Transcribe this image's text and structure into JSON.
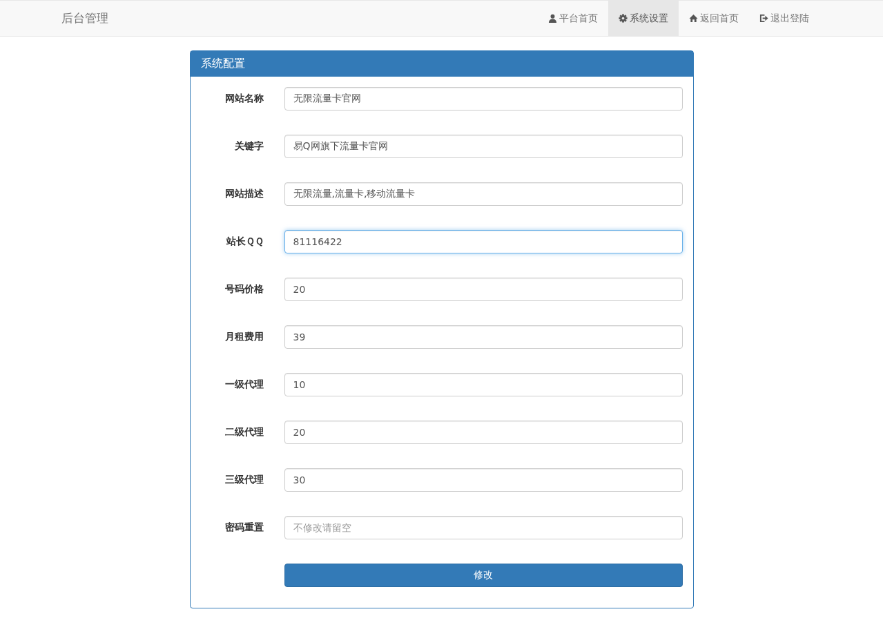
{
  "navbar": {
    "brand": "后台管理",
    "items": [
      {
        "label": "平台首页",
        "kind": "user",
        "selected": false
      },
      {
        "label": "系统设置",
        "kind": "gear",
        "selected": true
      },
      {
        "label": "返回首页",
        "kind": "home",
        "selected": false
      },
      {
        "label": "退出登陆",
        "kind": "logout",
        "selected": false
      }
    ]
  },
  "panel": {
    "title": "系统配置",
    "fields": [
      {
        "label": "网站名称",
        "value": "无限流量卡官网",
        "focused": false
      },
      {
        "label": "关键字",
        "value": "易Q网旗下流量卡官网",
        "focused": false
      },
      {
        "label": "网站描述",
        "value": "无限流量,流量卡,移动流量卡",
        "focused": false
      },
      {
        "label": "站长ＱＱ",
        "value": "81116422",
        "focused": true
      },
      {
        "label": "号码价格",
        "value": "20",
        "focused": false
      },
      {
        "label": "月租费用",
        "value": "39",
        "focused": false
      },
      {
        "label": "一级代理",
        "value": "10",
        "focused": false
      },
      {
        "label": "二级代理",
        "value": "20",
        "focused": false
      },
      {
        "label": "三级代理",
        "value": "30",
        "focused": false
      },
      {
        "label": "密码重置",
        "placeholder": "不修改请留空",
        "focused": false
      }
    ],
    "submit": "修改"
  }
}
